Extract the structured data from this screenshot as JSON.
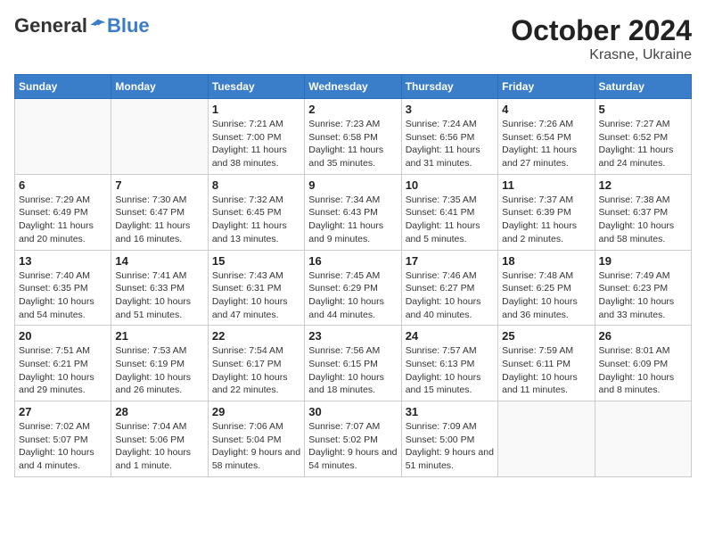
{
  "header": {
    "logo_general": "General",
    "logo_blue": "Blue",
    "month": "October 2024",
    "location": "Krasne, Ukraine"
  },
  "weekdays": [
    "Sunday",
    "Monday",
    "Tuesday",
    "Wednesday",
    "Thursday",
    "Friday",
    "Saturday"
  ],
  "weeks": [
    [
      {
        "day": "",
        "info": ""
      },
      {
        "day": "",
        "info": ""
      },
      {
        "day": "1",
        "info": "Sunrise: 7:21 AM\nSunset: 7:00 PM\nDaylight: 11 hours and 38 minutes."
      },
      {
        "day": "2",
        "info": "Sunrise: 7:23 AM\nSunset: 6:58 PM\nDaylight: 11 hours and 35 minutes."
      },
      {
        "day": "3",
        "info": "Sunrise: 7:24 AM\nSunset: 6:56 PM\nDaylight: 11 hours and 31 minutes."
      },
      {
        "day": "4",
        "info": "Sunrise: 7:26 AM\nSunset: 6:54 PM\nDaylight: 11 hours and 27 minutes."
      },
      {
        "day": "5",
        "info": "Sunrise: 7:27 AM\nSunset: 6:52 PM\nDaylight: 11 hours and 24 minutes."
      }
    ],
    [
      {
        "day": "6",
        "info": "Sunrise: 7:29 AM\nSunset: 6:49 PM\nDaylight: 11 hours and 20 minutes."
      },
      {
        "day": "7",
        "info": "Sunrise: 7:30 AM\nSunset: 6:47 PM\nDaylight: 11 hours and 16 minutes."
      },
      {
        "day": "8",
        "info": "Sunrise: 7:32 AM\nSunset: 6:45 PM\nDaylight: 11 hours and 13 minutes."
      },
      {
        "day": "9",
        "info": "Sunrise: 7:34 AM\nSunset: 6:43 PM\nDaylight: 11 hours and 9 minutes."
      },
      {
        "day": "10",
        "info": "Sunrise: 7:35 AM\nSunset: 6:41 PM\nDaylight: 11 hours and 5 minutes."
      },
      {
        "day": "11",
        "info": "Sunrise: 7:37 AM\nSunset: 6:39 PM\nDaylight: 11 hours and 2 minutes."
      },
      {
        "day": "12",
        "info": "Sunrise: 7:38 AM\nSunset: 6:37 PM\nDaylight: 10 hours and 58 minutes."
      }
    ],
    [
      {
        "day": "13",
        "info": "Sunrise: 7:40 AM\nSunset: 6:35 PM\nDaylight: 10 hours and 54 minutes."
      },
      {
        "day": "14",
        "info": "Sunrise: 7:41 AM\nSunset: 6:33 PM\nDaylight: 10 hours and 51 minutes."
      },
      {
        "day": "15",
        "info": "Sunrise: 7:43 AM\nSunset: 6:31 PM\nDaylight: 10 hours and 47 minutes."
      },
      {
        "day": "16",
        "info": "Sunrise: 7:45 AM\nSunset: 6:29 PM\nDaylight: 10 hours and 44 minutes."
      },
      {
        "day": "17",
        "info": "Sunrise: 7:46 AM\nSunset: 6:27 PM\nDaylight: 10 hours and 40 minutes."
      },
      {
        "day": "18",
        "info": "Sunrise: 7:48 AM\nSunset: 6:25 PM\nDaylight: 10 hours and 36 minutes."
      },
      {
        "day": "19",
        "info": "Sunrise: 7:49 AM\nSunset: 6:23 PM\nDaylight: 10 hours and 33 minutes."
      }
    ],
    [
      {
        "day": "20",
        "info": "Sunrise: 7:51 AM\nSunset: 6:21 PM\nDaylight: 10 hours and 29 minutes."
      },
      {
        "day": "21",
        "info": "Sunrise: 7:53 AM\nSunset: 6:19 PM\nDaylight: 10 hours and 26 minutes."
      },
      {
        "day": "22",
        "info": "Sunrise: 7:54 AM\nSunset: 6:17 PM\nDaylight: 10 hours and 22 minutes."
      },
      {
        "day": "23",
        "info": "Sunrise: 7:56 AM\nSunset: 6:15 PM\nDaylight: 10 hours and 18 minutes."
      },
      {
        "day": "24",
        "info": "Sunrise: 7:57 AM\nSunset: 6:13 PM\nDaylight: 10 hours and 15 minutes."
      },
      {
        "day": "25",
        "info": "Sunrise: 7:59 AM\nSunset: 6:11 PM\nDaylight: 10 hours and 11 minutes."
      },
      {
        "day": "26",
        "info": "Sunrise: 8:01 AM\nSunset: 6:09 PM\nDaylight: 10 hours and 8 minutes."
      }
    ],
    [
      {
        "day": "27",
        "info": "Sunrise: 7:02 AM\nSunset: 5:07 PM\nDaylight: 10 hours and 4 minutes."
      },
      {
        "day": "28",
        "info": "Sunrise: 7:04 AM\nSunset: 5:06 PM\nDaylight: 10 hours and 1 minute."
      },
      {
        "day": "29",
        "info": "Sunrise: 7:06 AM\nSunset: 5:04 PM\nDaylight: 9 hours and 58 minutes."
      },
      {
        "day": "30",
        "info": "Sunrise: 7:07 AM\nSunset: 5:02 PM\nDaylight: 9 hours and 54 minutes."
      },
      {
        "day": "31",
        "info": "Sunrise: 7:09 AM\nSunset: 5:00 PM\nDaylight: 9 hours and 51 minutes."
      },
      {
        "day": "",
        "info": ""
      },
      {
        "day": "",
        "info": ""
      }
    ]
  ]
}
